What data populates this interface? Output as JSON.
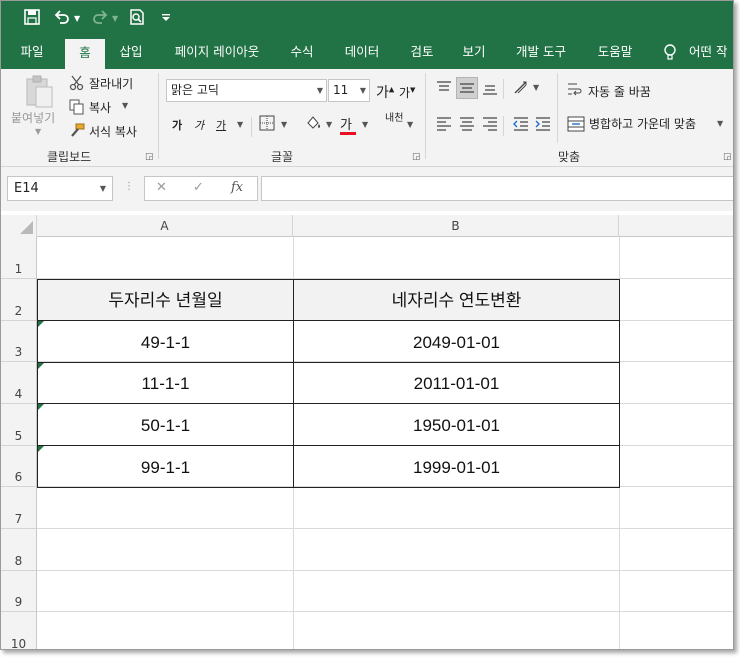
{
  "colors": {
    "accent": "#217346",
    "underline_red": "#e81123"
  },
  "quick_access": {
    "save_icon": "save-icon",
    "undo_icon": "undo-icon",
    "redo_icon": "redo-icon",
    "print_preview_icon": "print-preview-icon",
    "customize_icon": "customize-qat-icon"
  },
  "tabs": [
    {
      "label": "파일"
    },
    {
      "label": "홈"
    },
    {
      "label": "삽입"
    },
    {
      "label": "페이지 레이아웃"
    },
    {
      "label": "수식"
    },
    {
      "label": "데이터"
    },
    {
      "label": "검토"
    },
    {
      "label": "보기"
    },
    {
      "label": "개발 도구"
    },
    {
      "label": "도움말"
    },
    {
      "label": "어떤 작"
    }
  ],
  "ribbon": {
    "clipboard": {
      "paste_label": "붙여넣기",
      "cut_label": "잘라내기",
      "copy_label": "복사",
      "format_painter_label": "서식 복사",
      "group_label": "클립보드"
    },
    "font": {
      "font_name": "맑은 고딕",
      "font_size": "11",
      "increase_glyph": "가",
      "decrease_glyph": "가",
      "bold_glyph": "가",
      "italic_glyph": "가",
      "underline_glyph": "가",
      "font_color_glyph": "가",
      "phonetic_glyph": "내천",
      "group_label": "글꼴"
    },
    "alignment": {
      "wrap_text_label": "자동 줄 바꿈",
      "merge_center_label": "병합하고 가운데 맞춤",
      "group_label": "맞춤"
    }
  },
  "formula_bar": {
    "name_box": "E14",
    "cancel_glyph": "✕",
    "enter_glyph": "✓",
    "fx_glyph": "fx",
    "formula": ""
  },
  "sheet": {
    "columns": [
      "A",
      "B"
    ],
    "rows": [
      "1",
      "2",
      "3",
      "4",
      "5",
      "6",
      "7",
      "8",
      "9",
      "10"
    ],
    "header": {
      "a": "두자리수 년월일",
      "b": "네자리수 연도변환"
    },
    "data": [
      {
        "a": "49-1-1",
        "b": "2049-01-01"
      },
      {
        "a": "11-1-1",
        "b": "2011-01-01"
      },
      {
        "a": "50-1-1",
        "b": "1950-01-01"
      },
      {
        "a": "99-1-1",
        "b": "1999-01-01"
      }
    ]
  }
}
